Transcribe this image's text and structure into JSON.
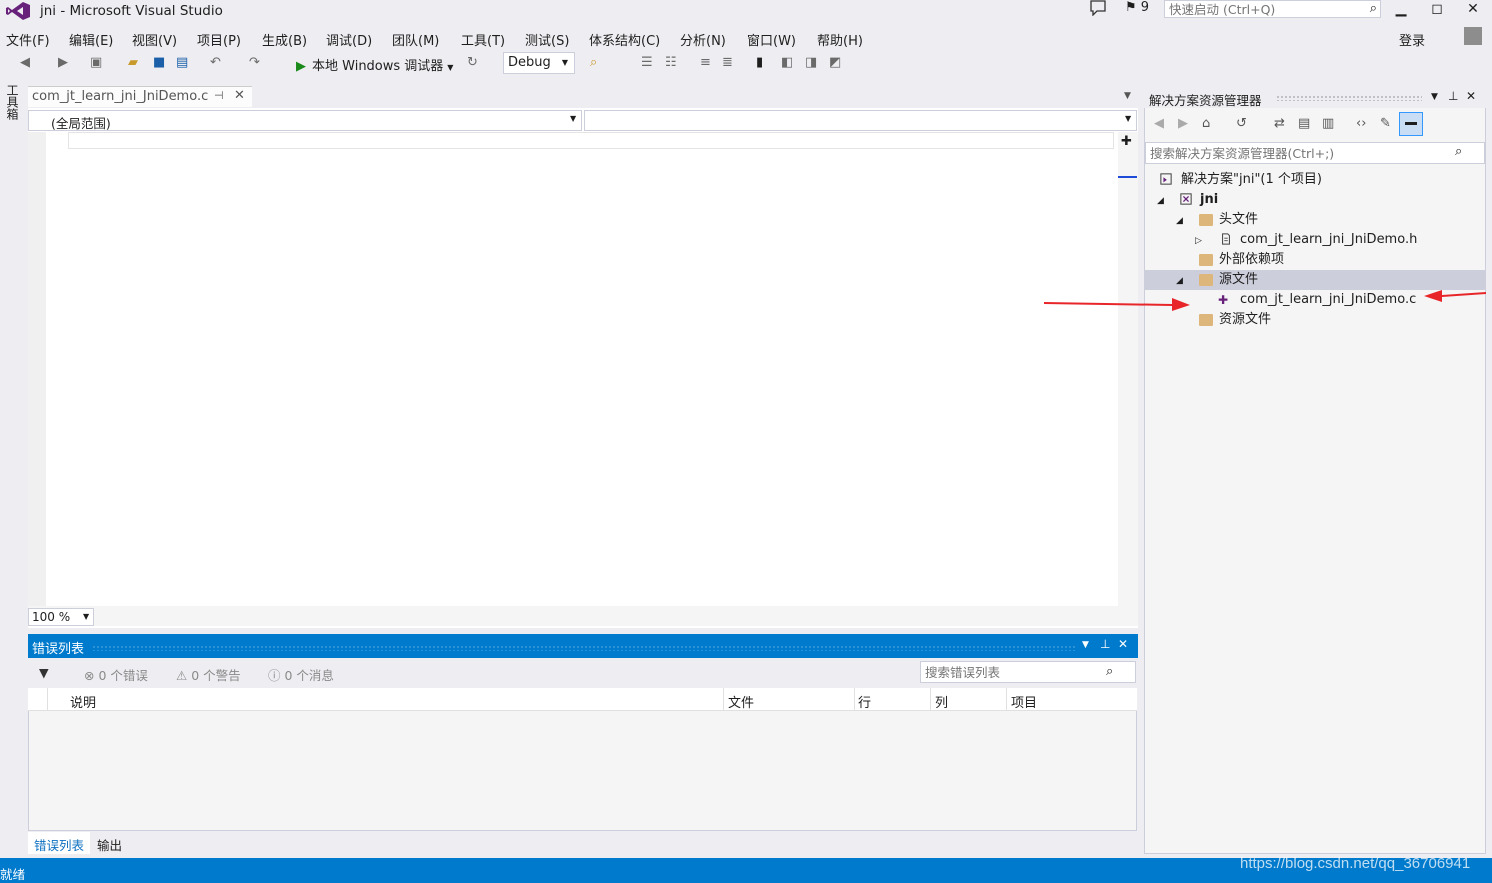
{
  "window": {
    "title": "jni - Microsoft Visual Studio",
    "feedback_count": "9",
    "quick_launch_placeholder": "快速启动 (Ctrl+Q)",
    "minimize": "▁",
    "maximize": "◻",
    "close": "✕"
  },
  "menu": [
    "文件(F)",
    "编辑(E)",
    "视图(V)",
    "项目(P)",
    "生成(B)",
    "调试(D)",
    "团队(M)",
    "工具(T)",
    "测试(S)",
    "体系结构(C)",
    "分析(N)",
    "窗口(W)",
    "帮助(H)"
  ],
  "account": {
    "login": "登录"
  },
  "toolbar": {
    "debugger_label": "本地 Windows 调试器",
    "config_value": "Debug"
  },
  "toolbox": {
    "label": "工具箱"
  },
  "editor": {
    "tab_label": "com_jt_learn_jni_JniDemo.c",
    "scope_value": "(全局范围)",
    "members_value": "",
    "zoom_value": "100 %"
  },
  "error_list": {
    "title": "错误列表",
    "errors": "0 个错误",
    "warnings": "0 个警告",
    "messages": "0 个消息",
    "search_placeholder": "搜索错误列表",
    "columns": [
      "说明",
      "文件",
      "行",
      "列",
      "项目"
    ]
  },
  "bottom_tabs": [
    "错误列表",
    "输出"
  ],
  "solution_explorer": {
    "title": "解决方案资源管理器",
    "search_placeholder": "搜索解决方案资源管理器(Ctrl+;)",
    "tree": [
      {
        "label": "解决方案\"jni\"(1 个项目)",
        "level": 0,
        "toggle": "",
        "icon": "solution"
      },
      {
        "label": "jni",
        "level": 0,
        "toggle": "◢",
        "icon": "project"
      },
      {
        "label": "头文件",
        "level": 1,
        "toggle": "◢",
        "icon": "folder"
      },
      {
        "label": "com_jt_learn_jni_JniDemo.h",
        "level": 2,
        "toggle": "▷",
        "icon": "header-file"
      },
      {
        "label": "外部依赖项",
        "level": 1,
        "toggle": "",
        "icon": "folder"
      },
      {
        "label": "源文件",
        "level": 1,
        "toggle": "◢",
        "icon": "folder",
        "selected": true
      },
      {
        "label": "com_jt_learn_jni_JniDemo.c",
        "level": 2,
        "toggle": "",
        "icon": "c-file"
      },
      {
        "label": "资源文件",
        "level": 1,
        "toggle": "",
        "icon": "folder"
      }
    ]
  },
  "status": {
    "text": "就绪"
  },
  "watermark": "https://blog.csdn.net/qq_36706941",
  "colors": {
    "accent": "#007acc",
    "vs_purple": "#68217a",
    "annotation_red": "#e8262a"
  }
}
